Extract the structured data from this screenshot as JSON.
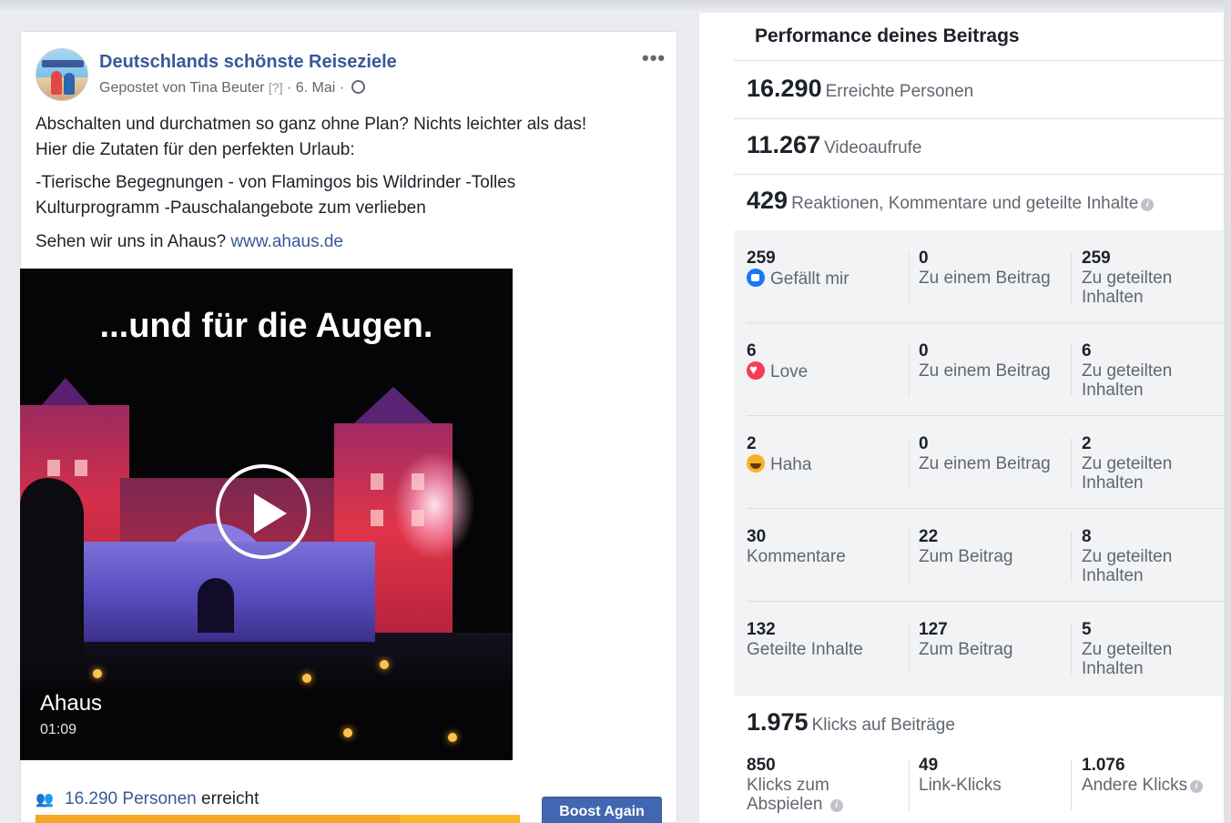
{
  "post": {
    "page_name": "Deutschlands schönste Reiseziele",
    "posted_by": "Gepostet von Tina Beuter",
    "help_marker": "[?]",
    "date": "6. Mai",
    "sep": "·",
    "more_icon": "•••",
    "text_line1": "Abschalten und durchatmen so ganz ohne Plan? Nichts leichter als das!",
    "text_line2": "Hier die Zutaten für den perfekten Urlaub:",
    "text_line3": "-Tierische Begegnungen - von Flamingos bis Wildrinder -Tolles",
    "text_line4": "Kulturprogramm -Pauschalangebote zum verlieben",
    "text_line5": "Sehen wir uns in Ahaus?",
    "link": "www.ahaus.de",
    "video": {
      "overlay_title": "...und für die Augen.",
      "name": "Ahaus",
      "duration": "01:09"
    },
    "reach_number": "16.290 Personen",
    "reach_suffix": "erreicht",
    "boost_label": "Boost Again"
  },
  "performance": {
    "title": "Performance deines Beitrags",
    "reach": {
      "value": "16.290",
      "label": "Erreichte Personen"
    },
    "views": {
      "value": "11.267",
      "label": "Videoaufrufe"
    },
    "engagement": {
      "value": "429",
      "label": "Reaktionen, Kommentare und geteilte Inhalte"
    },
    "rows": [
      {
        "total": "259",
        "label": "Gefällt mir",
        "icon": "like-icon",
        "on_post": "0",
        "on_post_label": "Zu einem Beitrag",
        "shared": "259",
        "shared_label_1": "Zu geteilten",
        "shared_label_2": "Inhalten"
      },
      {
        "total": "6",
        "label": "Love",
        "icon": "love-icon",
        "on_post": "0",
        "on_post_label": "Zu einem Beitrag",
        "shared": "6",
        "shared_label_1": "Zu geteilten",
        "shared_label_2": "Inhalten"
      },
      {
        "total": "2",
        "label": "Haha",
        "icon": "haha-icon",
        "on_post": "0",
        "on_post_label": "Zu einem Beitrag",
        "shared": "2",
        "shared_label_1": "Zu geteilten",
        "shared_label_2": "Inhalten"
      },
      {
        "total": "30",
        "label": "Kommentare",
        "on_post": "22",
        "on_post_label": "Zum Beitrag",
        "shared": "8",
        "shared_label_1": "Zu geteilten",
        "shared_label_2": "Inhalten"
      },
      {
        "total": "132",
        "label": "Geteilte Inhalte",
        "on_post": "127",
        "on_post_label": "Zum Beitrag",
        "shared": "5",
        "shared_label_1": "Zu geteilten",
        "shared_label_2": "Inhalten"
      }
    ],
    "clicks": {
      "value": "1.975",
      "label": "Klicks auf Beiträge"
    },
    "click_breakdown": [
      {
        "value": "850",
        "label_1": "Klicks zum",
        "label_2": "Abspielen"
      },
      {
        "value": "49",
        "label_1": "Link-Klicks"
      },
      {
        "value": "1.076",
        "label_1": "Andere Klicks"
      }
    ]
  }
}
